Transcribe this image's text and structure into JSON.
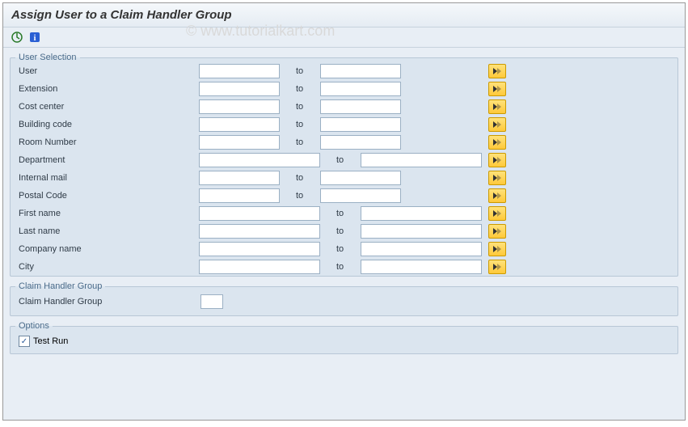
{
  "title": "Assign User to a Claim Handler Group",
  "watermark": "© www.tutorialkart.com",
  "toolbar": {
    "exec": "execute-icon",
    "info": "info-icon"
  },
  "to_label": "to",
  "sections": {
    "user_selection": {
      "legend": "User Selection",
      "rows": [
        {
          "label": "User",
          "wide": false
        },
        {
          "label": "Extension",
          "wide": false
        },
        {
          "label": "Cost center",
          "wide": false
        },
        {
          "label": "Building code",
          "wide": false
        },
        {
          "label": "Room Number",
          "wide": false
        },
        {
          "label": "Department",
          "wide": true
        },
        {
          "label": "Internal mail",
          "wide": false
        },
        {
          "label": "Postal Code",
          "wide": false
        },
        {
          "label": "First name",
          "wide": true
        },
        {
          "label": "Last name",
          "wide": true
        },
        {
          "label": "Company name",
          "wide": true
        },
        {
          "label": "City",
          "wide": true
        }
      ]
    },
    "claim_handler": {
      "legend": "Claim Handler Group",
      "field_label": "Claim Handler Group"
    },
    "options": {
      "legend": "Options",
      "test_run_label": "Test Run",
      "test_run_checked": true
    }
  }
}
